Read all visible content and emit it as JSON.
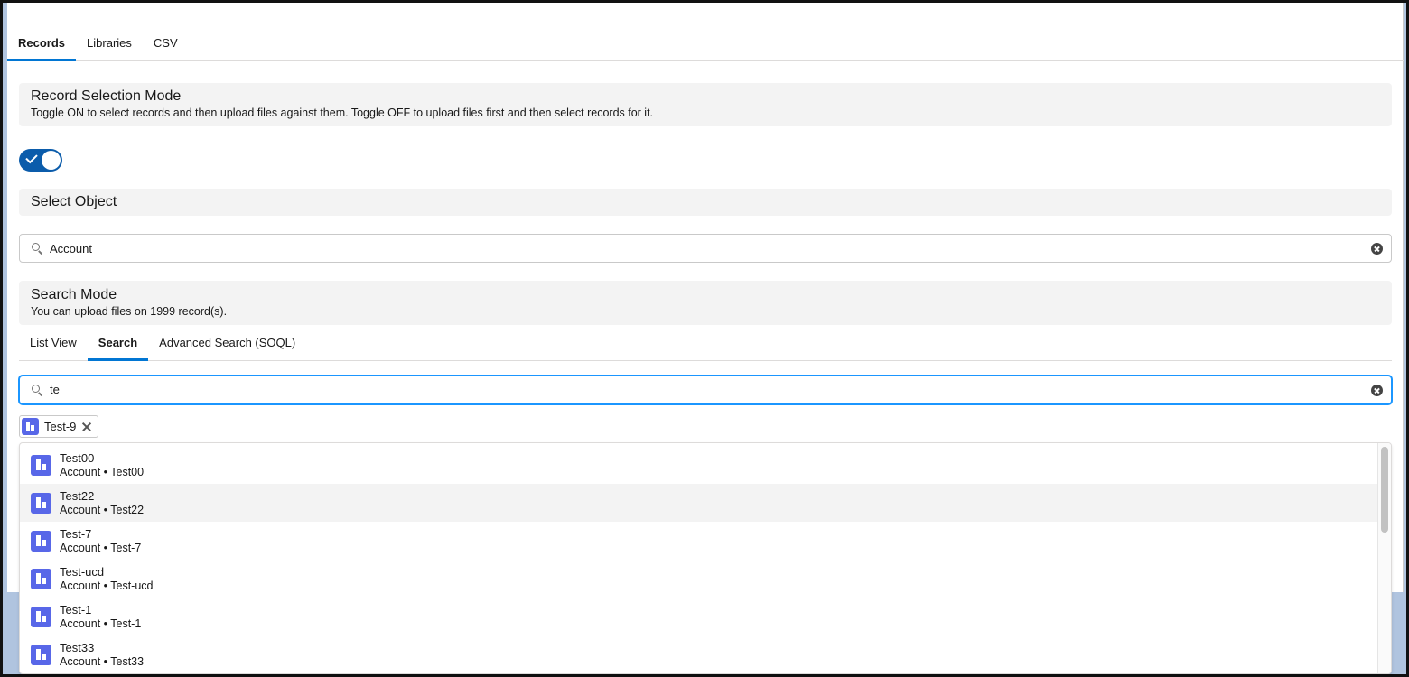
{
  "tabs": [
    {
      "label": "Records",
      "active": true
    },
    {
      "label": "Libraries",
      "active": false
    },
    {
      "label": "CSV",
      "active": false
    }
  ],
  "record_selection": {
    "title": "Record Selection Mode",
    "description": "Toggle ON to select records and then upload files against them. Toggle OFF to upload files first and then select records for it.",
    "toggle_on": true
  },
  "select_object": {
    "title": "Select Object",
    "value": "Account"
  },
  "search_mode": {
    "title": "Search Mode",
    "description": "You can upload files on 1999 record(s)."
  },
  "subtabs": [
    {
      "label": "List View",
      "active": false
    },
    {
      "label": "Search",
      "active": true
    },
    {
      "label": "Advanced Search (SOQL)",
      "active": false
    }
  ],
  "search": {
    "value": "te"
  },
  "selected_pills": [
    {
      "label": "Test-9"
    }
  ],
  "results": [
    {
      "title": "Test00",
      "meta": "Account • Test00"
    },
    {
      "title": "Test22",
      "meta": "Account • Test22"
    },
    {
      "title": "Test-7",
      "meta": "Account • Test-7"
    },
    {
      "title": "Test-ucd",
      "meta": "Account • Test-ucd"
    },
    {
      "title": "Test-1",
      "meta": "Account • Test-1"
    },
    {
      "title": "Test33",
      "meta": "Account • Test33"
    }
  ],
  "colors": {
    "accent": "#0176d3",
    "toggle": "#0b5cab",
    "object_icon": "#5867e8",
    "page_background": "#b0c4df"
  },
  "icons": {
    "search": "search-icon",
    "clear": "clear-icon",
    "object": "account-icon",
    "remove": "close-icon",
    "toggle_check": "check-icon"
  }
}
